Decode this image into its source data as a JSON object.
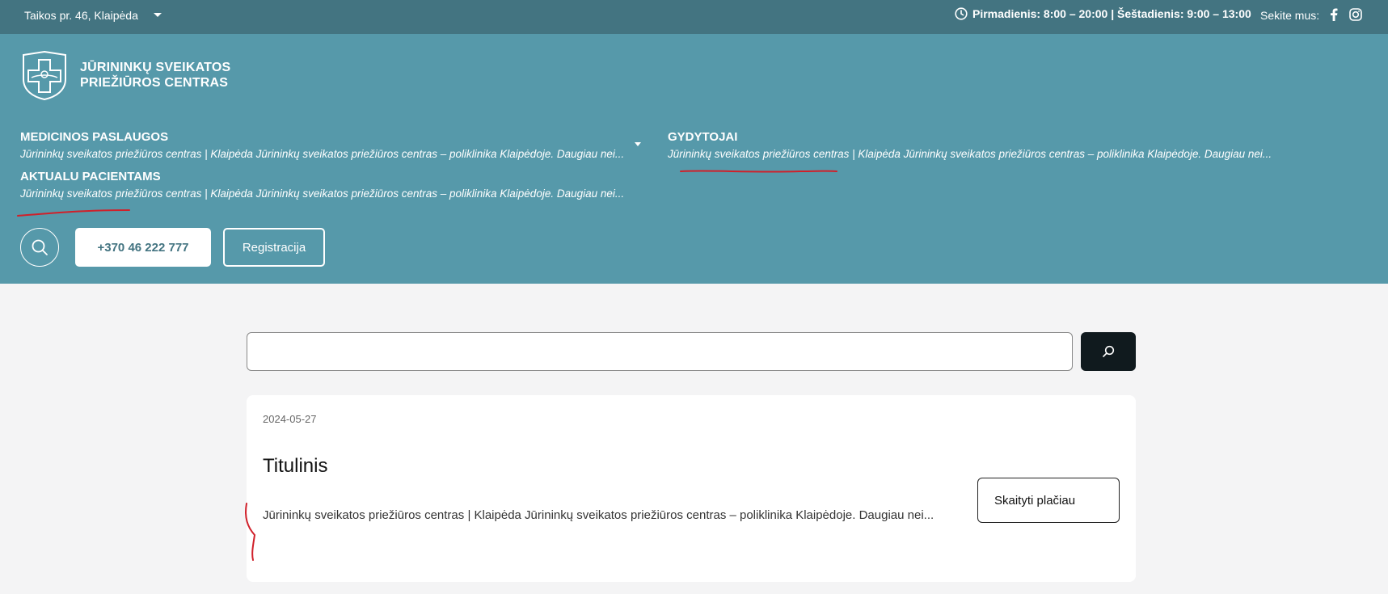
{
  "topbar": {
    "address": "Taikos pr. 46, Klaipėda",
    "hours": "Pirmadienis: 8:00 – 20:00 | Šeštadienis: 9:00 – 13:00",
    "follow_label": "Sekite mus:"
  },
  "header": {
    "brand_line1": "JŪRININKŲ SVEIKATOS",
    "brand_line2": "PRIEŽIŪROS CENTRAS",
    "nav": [
      {
        "title": "MEDICINOS PASLAUGOS",
        "desc": "Jūrininkų sveikatos priežiūros centras | Klaipėda Jūrininkų sveikatos priežiūros centras – poliklinika Klaipėdoje. Daugiau nei..."
      },
      {
        "title": "GYDYTOJAI",
        "desc": "Jūrininkų sveikatos priežiūros centras | Klaipėda Jūrininkų sveikatos priežiūros centras – poliklinika Klaipėdoje. Daugiau nei..."
      },
      {
        "title": "AKTUALU PACIENTAMS",
        "desc": "Jūrininkų sveikatos priežiūros centras | Klaipėda Jūrininkų sveikatos priežiūros centras – poliklinika Klaipėdoje. Daugiau nei..."
      }
    ],
    "phone": "+370 46 222 777",
    "register_label": "Registracija"
  },
  "search": {
    "value": "",
    "placeholder": ""
  },
  "result": {
    "date": "2024-05-27",
    "title": "Titulinis",
    "excerpt": "Jūrininkų sveikatos priežiūros centras | Klaipėda Jūrininkų sveikatos priežiūros centras – poliklinika Klaipėdoje. Daugiau nei...",
    "read_more": "Skaityti plačiau"
  },
  "colors": {
    "topbar": "#437481",
    "header": "#5699aa",
    "background": "#f4f4f5",
    "search_button": "#101a1e",
    "annotation": "#d0202a"
  },
  "icons": [
    "clock-icon",
    "facebook-icon",
    "instagram-icon",
    "search-icon",
    "logo-cross-icon"
  ]
}
